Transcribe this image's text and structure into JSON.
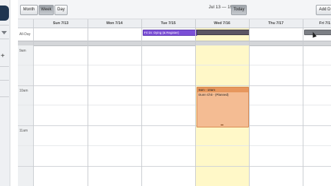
{
  "toolbar": {
    "views": [
      "Month",
      "Week",
      "Day"
    ],
    "active_view": "Week",
    "range_title": "Jul 13 — 19 2014",
    "today_label": "Today",
    "add_label": "Add D"
  },
  "grid": {
    "days": [
      "Sun 7/13",
      "Mon 7/14",
      "Tue 7/15",
      "Wed 7/16",
      "Thu 7/17",
      "Fri 7/1"
    ],
    "today_index": 3,
    "allday_label": "All-Day",
    "hours": [
      "9am",
      "10am",
      "11am"
    ]
  },
  "events": {
    "allday_tue_title": "Fri Dr. Oying (& Register)",
    "timed_wed_time": "9am - 10am",
    "timed_wed_title": "Dunn Chit - (Planned)"
  },
  "colors": {
    "today_bg": "#fff8c8",
    "event_purple": "#7b4fd6",
    "event_orange": "#f4bc93"
  }
}
